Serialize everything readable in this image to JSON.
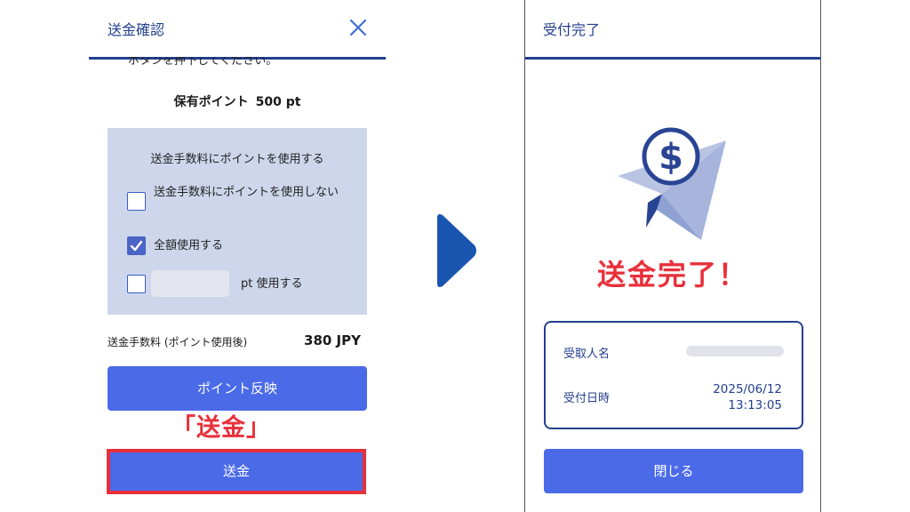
{
  "left_screen": {
    "title": "送金確認",
    "instruction": "ボタンを押下してください。",
    "points_label": "保有ポイント",
    "points_value": "500 pt",
    "fee_options": {
      "title": "送金手数料にポイントを使用する",
      "options": [
        {
          "label": "送金手数料にポイントを使用しない",
          "checked": false
        },
        {
          "label": "全額使用する",
          "checked": true
        },
        {
          "label": "pt 使用する",
          "checked": false,
          "input_value": ""
        }
      ]
    },
    "fee_label": "送金手数料 (ポイント使用後)",
    "fee_value": "380 JPY",
    "reflect_button": "ポイント反映",
    "annotation": "「送金」",
    "send_button": "送金"
  },
  "right_screen": {
    "title": "受付完了",
    "done_text": "送金完了！",
    "recipient_label": "受取人名",
    "date_label": "受付日時",
    "date_value": "2025/06/12",
    "time_value": "13:13:05",
    "close_button": "閉じる"
  },
  "colors": {
    "navy": "#23408e",
    "button_blue": "#4a6ae8",
    "annotation_red": "#e8303a",
    "option_box": "#cdd6ea"
  }
}
